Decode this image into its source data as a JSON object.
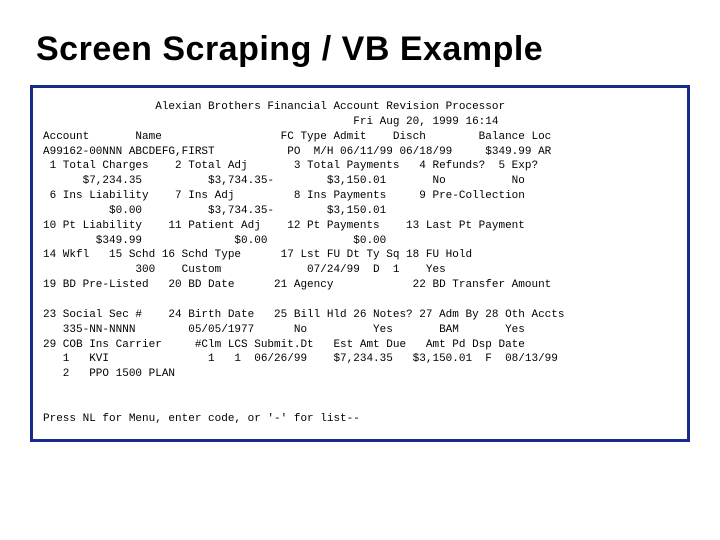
{
  "title": "Screen Scraping / VB Example",
  "header_line1": "                 Alexian Brothers Financial Account Revision Processor",
  "header_line2": "                                               Fri Aug 20, 1999 16:14",
  "cols_line": "Account       Name                  FC Type Admit    Disch        Balance Loc",
  "rec_line": "A99162-00NNN ABCDEFG,FIRST           PO  M/H 06/11/99 06/18/99     $349.99 AR",
  "r1": " 1 Total Charges    2 Total Adj       3 Total Payments   4 Refunds?  5 Exp?",
  "r1v": "      $7,234.35          $3,734.35-        $3,150.01       No          No",
  "r6": " 6 Ins Liability    7 Ins Adj         8 Ins Payments     9 Pre-Collection",
  "r6v": "          $0.00          $3,734.35-        $3,150.01",
  "r10": "10 Pt Liability    11 Patient Adj    12 Pt Payments    13 Last Pt Payment",
  "r10v": "        $349.99              $0.00             $0.00",
  "r14": "14 Wkfl   15 Schd 16 Schd Type      17 Lst FU Dt Ty Sq 18 FU Hold",
  "r14v": "              300    Custom             07/24/99  D  1    Yes",
  "r19": "19 BD Pre-Listed   20 BD Date      21 Agency            22 BD Transfer Amount",
  "blank": "",
  "r23": "23 Social Sec #    24 Birth Date   25 Bill Hld 26 Notes? 27 Adm By 28 Oth Accts",
  "r23v": "   335-NN-NNNN        05/05/1977      No          Yes       BAM       Yes",
  "r29": "29 COB Ins Carrier     #Clm LCS Submit.Dt   Est Amt Due   Amt Pd Dsp Date",
  "r29a": "   1   KVI               1   1  06/26/99    $7,234.35   $3,150.01  F  08/13/99",
  "r29b": "   2   PPO 1500 PLAN",
  "prompt": "Press NL for Menu, enter code, or '-' for list--"
}
